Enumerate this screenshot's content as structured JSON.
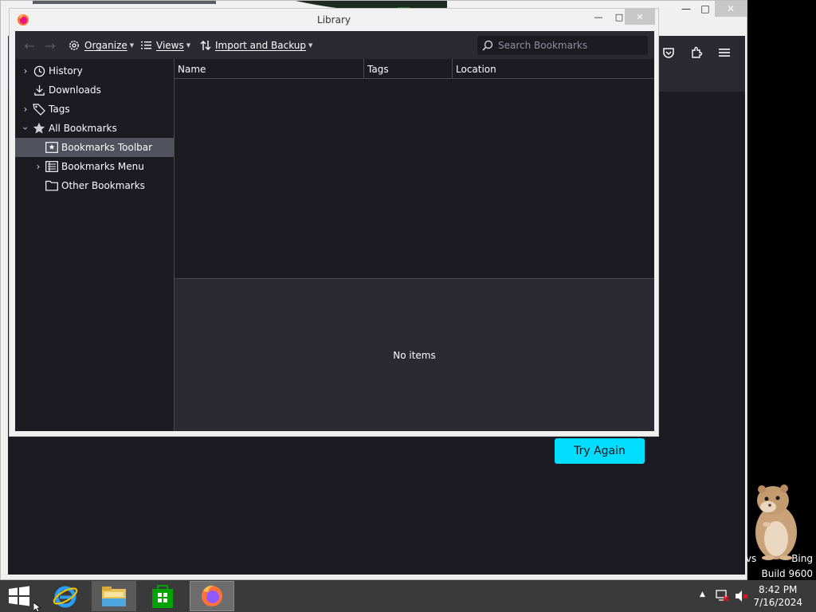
{
  "background_window": {
    "try_again_label": "Try Again",
    "watermark_line1": "vs",
    "watermark_line1b": "Bing",
    "watermark_line2": "Build 9600"
  },
  "library": {
    "title": "Library",
    "toolbar": {
      "organize_label": "Organize",
      "views_label": "Views",
      "import_backup_label": "Import and Backup",
      "search_placeholder": "Search Bookmarks"
    },
    "sidebar": {
      "items": [
        {
          "label": "History",
          "icon": "clock-icon",
          "expandable": true,
          "expanded": false
        },
        {
          "label": "Downloads",
          "icon": "download-icon",
          "expandable": false
        },
        {
          "label": "Tags",
          "icon": "tag-icon",
          "expandable": true,
          "expanded": false
        },
        {
          "label": "All Bookmarks",
          "icon": "star-icon",
          "expandable": true,
          "expanded": true
        },
        {
          "label": "Bookmarks Toolbar",
          "icon": "bookmark-toolbar-icon",
          "expandable": false,
          "selected": true
        },
        {
          "label": "Bookmarks Menu",
          "icon": "bookmark-menu-icon",
          "expandable": true,
          "expanded": false
        },
        {
          "label": "Other Bookmarks",
          "icon": "folder-icon",
          "expandable": false
        }
      ]
    },
    "columns": [
      "Name",
      "Tags",
      "Location"
    ],
    "details_empty_text": "No items"
  },
  "taskbar": {
    "apps": [
      {
        "name": "internet-explorer",
        "icon": "ie-icon"
      },
      {
        "name": "file-explorer",
        "icon": "folder-icon"
      },
      {
        "name": "store",
        "icon": "store-icon"
      },
      {
        "name": "firefox",
        "icon": "firefox-icon",
        "active": true
      }
    ],
    "clock_time": "8:42 PM",
    "clock_date": "7/16/2024"
  },
  "colors": {
    "accent": "#00ddff",
    "toolbar_bg": "#2b2a33",
    "content_bg": "#1c1b22",
    "selected_row": "#52525e",
    "taskbar_bg": "#3a3a3a"
  }
}
